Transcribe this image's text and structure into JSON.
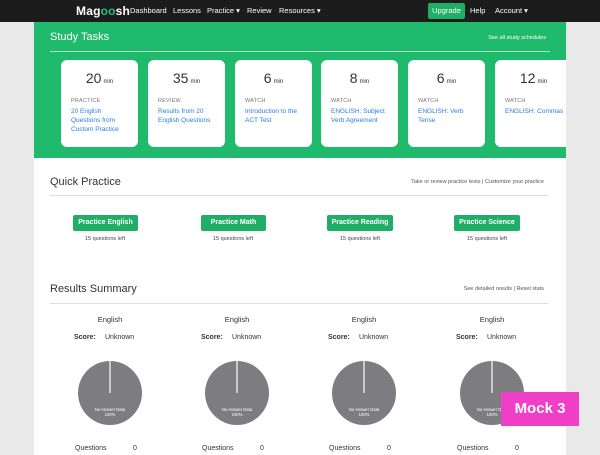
{
  "nav": {
    "logo_pre": "Mag",
    "logo_mid": "oo",
    "logo_post": "sh",
    "dashboard": "Dashboard",
    "lessons": "Lessons",
    "practice": "Practice ▾",
    "review": "Review",
    "resources": "Resources ▾",
    "upgrade": "Upgrade",
    "help": "Help",
    "account": "Account ▾"
  },
  "study": {
    "title": "Study Tasks",
    "link": "See all study schedules",
    "tasks": [
      {
        "num": "20",
        "unit": "min",
        "type": "PRACTICE",
        "desc": "20 English Questions from Custom Practice"
      },
      {
        "num": "35",
        "unit": "min",
        "type": "REVIEW",
        "desc": "Results from 20 English Questions"
      },
      {
        "num": "6",
        "unit": "min",
        "type": "WATCH",
        "desc": "Introduction to the ACT Test"
      },
      {
        "num": "8",
        "unit": "min",
        "type": "WATCH",
        "desc": "ENGLISH: Subject Verb Agreement"
      },
      {
        "num": "6",
        "unit": "min",
        "type": "WATCH",
        "desc": "ENGLISH: Verb Tense"
      },
      {
        "num": "12",
        "unit": "min",
        "type": "WATCH",
        "desc": "ENGLISH: Commas"
      }
    ]
  },
  "quick": {
    "title": "Quick Practice",
    "link": "Take or review practice tests | Customize your practice",
    "buttons": [
      {
        "label": "Practice English",
        "sub": "15 questions left"
      },
      {
        "label": "Practice Math",
        "sub": "15 questions left"
      },
      {
        "label": "Practice Reading",
        "sub": "15 questions left"
      },
      {
        "label": "Practice Science",
        "sub": "15 questions left"
      }
    ]
  },
  "results": {
    "title": "Results Summary",
    "link": "See detailed results | Reset stats",
    "cards": [
      {
        "subject": "English",
        "score_label": "Score:",
        "score": "Unknown",
        "pie_label": "No Answer Data",
        "pie_pct": "100%",
        "q_label": "Questions",
        "q_val": "0",
        "pie_fraction": 1.0
      },
      {
        "subject": "English",
        "score_label": "Score:",
        "score": "Unknown",
        "pie_label": "No Answer Data",
        "pie_pct": "100%",
        "q_label": "Questions",
        "q_val": "0",
        "pie_fraction": 1.0
      },
      {
        "subject": "English",
        "score_label": "Score:",
        "score": "Unknown",
        "pie_label": "No Answer Data",
        "pie_pct": "100%",
        "q_label": "Questions",
        "q_val": "0",
        "pie_fraction": 1.0
      },
      {
        "subject": "English",
        "score_label": "Score:",
        "score": "Unknown",
        "pie_label": "No Answer Data",
        "pie_pct": "100%",
        "q_label": "Questions",
        "q_val": "0",
        "pie_fraction": 1.0
      }
    ]
  },
  "badge": "Mock 3",
  "colors": {
    "green": "#1fba6b",
    "nav_bg": "#1c1c1c",
    "link_blue": "#2b7de0",
    "pie_gray": "#7d7c80",
    "badge_pink": "#f03ec6"
  }
}
